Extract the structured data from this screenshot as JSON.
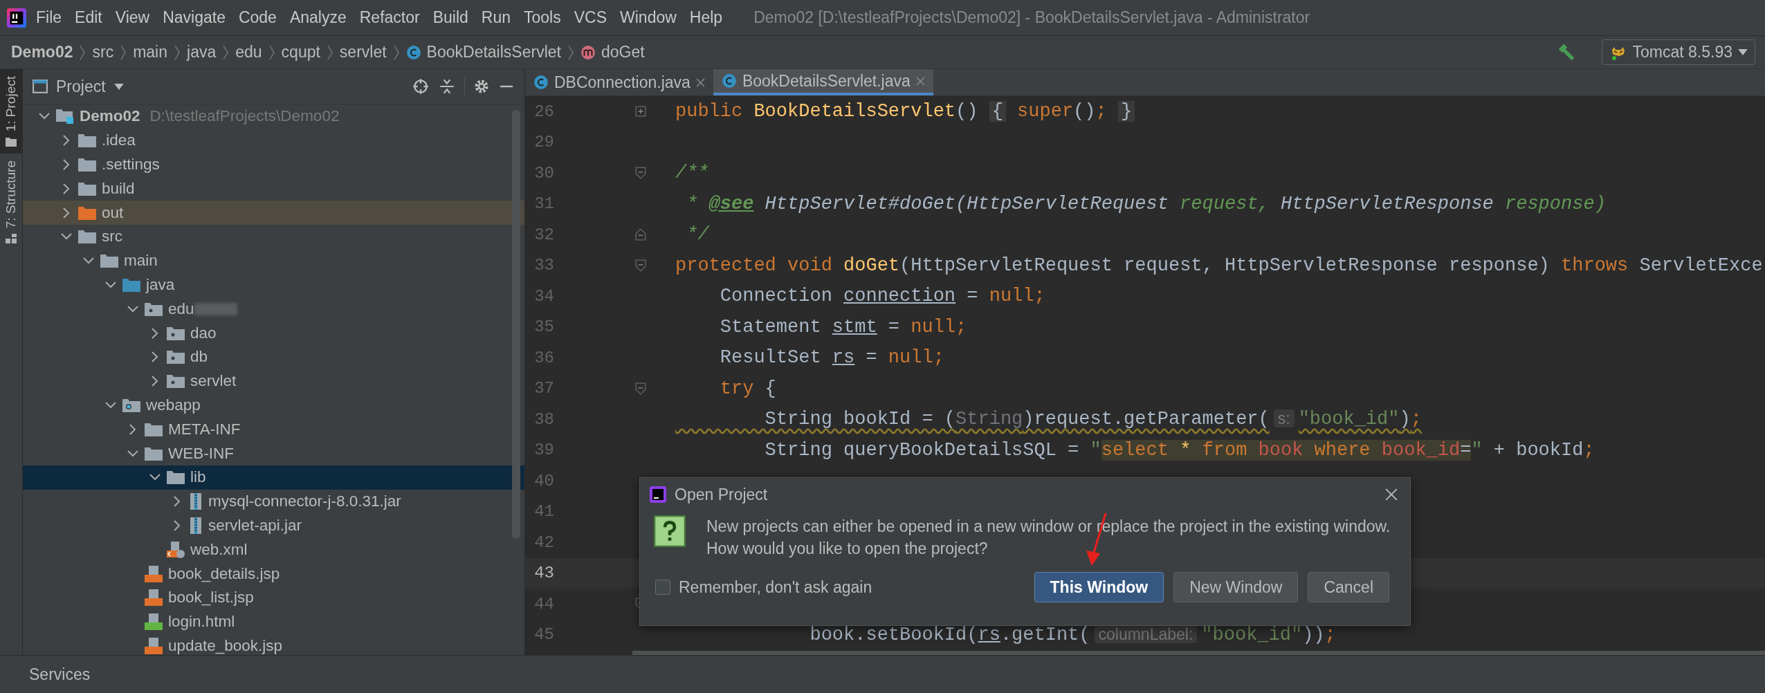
{
  "menu": [
    "File",
    "Edit",
    "View",
    "Navigate",
    "Code",
    "Analyze",
    "Refactor",
    "Build",
    "Run",
    "Tools",
    "VCS",
    "Window",
    "Help"
  ],
  "window": {
    "title": "Demo02 [D:\\testleafProjects\\Demo02] - BookDetailsServlet.java - Administrator"
  },
  "breadcrumb": [
    {
      "label": "Demo02",
      "kind": "project"
    },
    {
      "label": "src",
      "kind": "folder"
    },
    {
      "label": "main",
      "kind": "folder"
    },
    {
      "label": "java",
      "kind": "folder"
    },
    {
      "label": "edu",
      "kind": "folder"
    },
    {
      "label": "cqupt",
      "kind": "folder"
    },
    {
      "label": "servlet",
      "kind": "folder"
    },
    {
      "label": "BookDetailsServlet",
      "kind": "class"
    },
    {
      "label": "doGet",
      "kind": "method"
    }
  ],
  "run_config": {
    "label": "Tomcat 8.5.93"
  },
  "side_tabs": [
    {
      "label": "1: Project",
      "selected": true,
      "kind": "project"
    },
    {
      "label": "7: Structure",
      "selected": false,
      "kind": "structure"
    }
  ],
  "project_panel": {
    "title": "Project",
    "tree": [
      {
        "label": "Demo02",
        "path": "D:\\testleafProjects\\Demo02",
        "kind": "module",
        "expanded": true,
        "selected": false,
        "highlighted": false,
        "children": [
          {
            "label": ".idea",
            "kind": "folder",
            "expanded": false,
            "selected": false,
            "highlighted": false
          },
          {
            "label": ".settings",
            "kind": "folder",
            "expanded": false,
            "selected": false,
            "highlighted": false
          },
          {
            "label": "build",
            "kind": "folder",
            "expanded": false,
            "selected": false,
            "highlighted": false
          },
          {
            "label": "out",
            "kind": "excluded",
            "expanded": false,
            "selected": false,
            "highlighted": true
          },
          {
            "label": "src",
            "kind": "folder",
            "expanded": true,
            "selected": false,
            "highlighted": false,
            "children": [
              {
                "label": "main",
                "kind": "folder",
                "expanded": true,
                "selected": false,
                "highlighted": false,
                "children": [
                  {
                    "label": "java",
                    "kind": "source",
                    "expanded": true,
                    "selected": false,
                    "highlighted": false,
                    "children": [
                      {
                        "label": "edu",
                        "kind": "package",
                        "redacted": true,
                        "expanded": true,
                        "selected": false,
                        "highlighted": false,
                        "children": [
                          {
                            "label": "dao",
                            "kind": "package",
                            "expanded": false,
                            "selected": false,
                            "highlighted": false
                          },
                          {
                            "label": "db",
                            "kind": "package",
                            "expanded": false,
                            "selected": false,
                            "highlighted": false
                          },
                          {
                            "label": "servlet",
                            "kind": "package",
                            "expanded": false,
                            "selected": false,
                            "highlighted": false
                          }
                        ]
                      }
                    ]
                  },
                  {
                    "label": "webapp",
                    "kind": "web",
                    "expanded": true,
                    "selected": false,
                    "highlighted": false,
                    "children": [
                      {
                        "label": "META-INF",
                        "kind": "folder",
                        "expanded": false,
                        "selected": false,
                        "highlighted": false
                      },
                      {
                        "label": "WEB-INF",
                        "kind": "folder",
                        "expanded": true,
                        "selected": false,
                        "highlighted": false,
                        "children": [
                          {
                            "label": "lib",
                            "kind": "folder",
                            "expanded": true,
                            "selected": true,
                            "highlighted": false,
                            "children": [
                              {
                                "label": "mysql-connector-j-8.0.31.jar",
                                "kind": "jar",
                                "expanded": false,
                                "selected": false,
                                "highlighted": false
                              },
                              {
                                "label": "servlet-api.jar",
                                "kind": "jar",
                                "expanded": false,
                                "selected": false,
                                "highlighted": false
                              }
                            ]
                          },
                          {
                            "label": "web.xml",
                            "kind": "xml",
                            "selected": false,
                            "highlighted": false
                          }
                        ]
                      },
                      {
                        "label": "book_details.jsp",
                        "kind": "jsp",
                        "selected": false,
                        "highlighted": false
                      },
                      {
                        "label": "book_list.jsp",
                        "kind": "jsp",
                        "selected": false,
                        "highlighted": false
                      },
                      {
                        "label": "login.html",
                        "kind": "html",
                        "selected": false,
                        "highlighted": false
                      },
                      {
                        "label": "update_book.jsp",
                        "kind": "jsp",
                        "selected": false,
                        "highlighted": false
                      }
                    ]
                  }
                ]
              }
            ]
          }
        ]
      }
    ]
  },
  "tabs": [
    {
      "label": "DBConnection.java",
      "selected": false
    },
    {
      "label": "BookDetailsServlet.java",
      "selected": true
    }
  ],
  "editor": {
    "lines": [
      {
        "number": "26",
        "kind": "folded",
        "current": false,
        "tokens": [
          {
            "text": "public ",
            "kind": "keyword"
          },
          {
            "text": "BookDetailsServlet",
            "kind": "function"
          },
          {
            "text": "() ",
            "kind": "plain"
          },
          {
            "text": "{",
            "kind": "folded"
          },
          {
            "text": " super",
            "kind": "keyword"
          },
          {
            "text": "()",
            "kind": "plain"
          },
          {
            "text": "; ",
            "kind": "keyword"
          },
          {
            "text": "}",
            "kind": "folded"
          }
        ]
      },
      {
        "number": "29",
        "kind": "plain",
        "current": false
      },
      {
        "number": "30",
        "kind": "fold_start",
        "current": false,
        "tokens": [
          {
            "text": "/**",
            "kind": "comment"
          }
        ]
      },
      {
        "number": "31",
        "kind": "plain",
        "current": false,
        "tokens": [
          {
            "text": " * ",
            "kind": "comment"
          },
          {
            "text": "@see",
            "kind": "doctag"
          },
          {
            "text": " HttpServlet#doGet(HttpServletRequest",
            "kind": "docref"
          },
          {
            "text": " request, ",
            "kind": "comment"
          },
          {
            "text": "HttpServletResponse",
            "kind": "docref"
          },
          {
            "text": " response)",
            "kind": "comment"
          }
        ]
      },
      {
        "number": "32",
        "kind": "fold_end",
        "current": false,
        "tokens": [
          {
            "text": " */",
            "kind": "comment"
          }
        ]
      },
      {
        "number": "33",
        "kind": "fold_start",
        "current": false,
        "tokens": [
          {
            "text": "protected void ",
            "kind": "keyword"
          },
          {
            "text": "doGet",
            "kind": "function"
          },
          {
            "text": "(HttpServletRequest request, HttpServletResponse response) ",
            "kind": "plain"
          },
          {
            "text": "throws",
            "kind": "keyword"
          },
          {
            "text": " ServletExce",
            "kind": "plain"
          }
        ]
      },
      {
        "number": "34",
        "kind": "plain",
        "current": false,
        "tokens": [
          {
            "text": "    Connection ",
            "kind": "plain"
          },
          {
            "text": "connection",
            "kind": "variable"
          },
          {
            "text": " = ",
            "kind": "plain"
          },
          {
            "text": "null;",
            "kind": "keyword"
          }
        ]
      },
      {
        "number": "35",
        "kind": "plain",
        "current": false,
        "tokens": [
          {
            "text": "    Statement ",
            "kind": "plain"
          },
          {
            "text": "stmt",
            "kind": "variable"
          },
          {
            "text": " = ",
            "kind": "plain"
          },
          {
            "text": "null;",
            "kind": "keyword"
          }
        ]
      },
      {
        "number": "36",
        "kind": "plain",
        "current": false,
        "tokens": [
          {
            "text": "    ResultSet ",
            "kind": "plain"
          },
          {
            "text": "rs",
            "kind": "variable"
          },
          {
            "text": " = ",
            "kind": "plain"
          },
          {
            "text": "null;",
            "kind": "keyword"
          }
        ]
      },
      {
        "number": "37",
        "kind": "fold_start",
        "current": false,
        "tokens": [
          {
            "text": "    try",
            "kind": "keyword"
          },
          {
            "text": " {",
            "kind": "plain"
          }
        ]
      },
      {
        "number": "38",
        "kind": "plain",
        "current": false,
        "tokens": [
          {
            "text": "        String bookId = (",
            "kind": "plain",
            "warning": true
          },
          {
            "text": "String",
            "kind": "dim",
            "warning": true
          },
          {
            "text": ")request.getParameter(",
            "kind": "plain",
            "warning": true
          },
          {
            "text": "s:",
            "kind": "hint"
          },
          {
            "text": "\"book_id\"",
            "kind": "string",
            "warning": true
          },
          {
            "text": ")",
            "kind": "plain",
            "warning": true
          },
          {
            "text": ";",
            "kind": "keyword",
            "warning": true
          }
        ]
      },
      {
        "number": "39",
        "kind": "plain",
        "current": false,
        "tokens": [
          {
            "text": "        String queryBookDetailsSQL = ",
            "kind": "plain"
          },
          {
            "text": "\"",
            "kind": "string"
          },
          {
            "text": "select ",
            "kind": "sql_keyword"
          },
          {
            "text": "* ",
            "kind": "sql_operator"
          },
          {
            "text": "from ",
            "kind": "sql_keyword"
          },
          {
            "text": "book ",
            "kind": "sql_name"
          },
          {
            "text": "where ",
            "kind": "sql_keyword"
          },
          {
            "text": "book_id",
            "kind": "sql_name"
          },
          {
            "text": "=",
            "kind": "sql_plain"
          },
          {
            "text": "\"",
            "kind": "string"
          },
          {
            "text": " + bookId",
            "kind": "plain"
          },
          {
            "text": ";",
            "kind": "keyword"
          }
        ]
      },
      {
        "number": "40",
        "kind": "plain",
        "current": false
      },
      {
        "number": "41",
        "kind": "plain",
        "current": false
      },
      {
        "number": "42",
        "kind": "plain",
        "current": false
      },
      {
        "number": "43",
        "kind": "plain",
        "current": true
      },
      {
        "number": "44",
        "kind": "fold_start",
        "current": false
      },
      {
        "number": "45",
        "kind": "plain",
        "current": false,
        "tokens": [
          {
            "text": "            book.setBookId(",
            "kind": "plain"
          },
          {
            "text": "rs",
            "kind": "variable"
          },
          {
            "text": ".getInt(",
            "kind": "plain"
          },
          {
            "text": "columnLabel:",
            "kind": "hint"
          },
          {
            "text": "\"book_id\"",
            "kind": "string"
          },
          {
            "text": "))",
            "kind": "plain"
          },
          {
            "text": ";",
            "kind": "keyword"
          }
        ]
      }
    ]
  },
  "dialog": {
    "title": "Open Project",
    "message_lines": [
      "New projects can either be opened in a new window or replace the project in the existing window.",
      "How would you like to open the project?"
    ],
    "checkbox": {
      "label": "Remember, don't ask again",
      "checked": false
    },
    "buttons": [
      {
        "label": "This Window",
        "default": true
      },
      {
        "label": "New Window",
        "default": false
      },
      {
        "label": "Cancel",
        "default": false
      }
    ]
  },
  "bottom_bar": {
    "label": "Services"
  }
}
